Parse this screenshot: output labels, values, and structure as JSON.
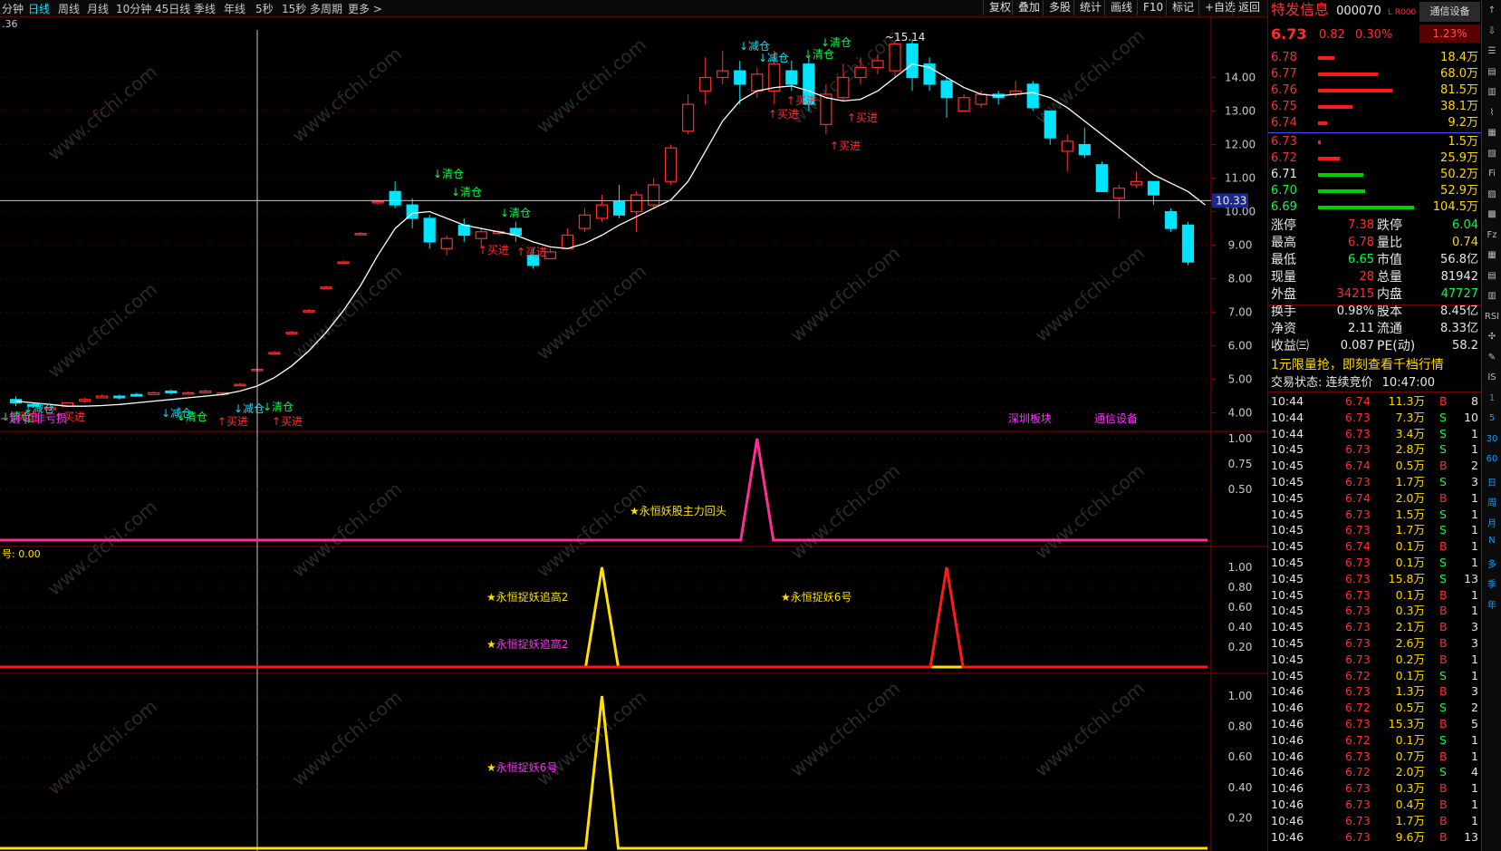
{
  "toolbar": {
    "tabs": [
      {
        "label": "分钟",
        "active": false
      },
      {
        "label": "日线",
        "active": true
      },
      {
        "label": "周线",
        "active": false
      },
      {
        "label": "月线",
        "active": false
      },
      {
        "label": "10分钟",
        "active": false
      },
      {
        "label": "45日线",
        "active": false
      },
      {
        "label": "季线",
        "active": false
      },
      {
        "label": "年线",
        "active": false
      },
      {
        "label": "5秒",
        "active": false
      },
      {
        "label": "15秒",
        "active": false
      },
      {
        "label": "多周期",
        "active": false
      },
      {
        "label": "更多 >",
        "active": false
      }
    ],
    "tools": [
      "复权",
      "叠加",
      "多股",
      "统计",
      "画线",
      "F10",
      "标记",
      "+自选",
      "返回"
    ]
  },
  "chart_data": [
    {
      "type": "candlestick",
      "title": "",
      "corner_label": ".36",
      "ylim": [
        3.8,
        15.5
      ],
      "yticks": [
        "14.00",
        "13.00",
        "12.00",
        "11.00",
        "10.00",
        "9.00",
        "8.00",
        "7.00",
        "6.00",
        "5.00",
        "4.00"
      ],
      "crosshair_price": "10.33",
      "candles": [
        {
          "o": 4.4,
          "c": 4.3,
          "h": 4.5,
          "l": 4.2
        },
        {
          "o": 4.25,
          "c": 4.2,
          "h": 4.3,
          "l": 4.15
        },
        {
          "o": 4.1,
          "c": 4.15,
          "h": 4.2,
          "l": 4.1
        },
        {
          "o": 4.2,
          "c": 4.3,
          "h": 4.3,
          "l": 4.2
        },
        {
          "o": 4.35,
          "c": 4.4,
          "h": 4.45,
          "l": 4.3
        },
        {
          "o": 4.45,
          "c": 4.5,
          "h": 4.55,
          "l": 4.45
        },
        {
          "o": 4.5,
          "c": 4.45,
          "h": 4.55,
          "l": 4.4
        },
        {
          "o": 4.55,
          "c": 4.5,
          "h": 4.6,
          "l": 4.5
        },
        {
          "o": 4.55,
          "c": 4.6,
          "h": 4.65,
          "l": 4.55
        },
        {
          "o": 4.65,
          "c": 4.6,
          "h": 4.7,
          "l": 4.55
        },
        {
          "o": 4.6,
          "c": 4.6,
          "h": 4.65,
          "l": 4.6
        },
        {
          "o": 4.6,
          "c": 4.65,
          "h": 4.7,
          "l": 4.6
        },
        {
          "o": 4.55,
          "c": 4.6,
          "h": 4.6,
          "l": 4.5
        },
        {
          "o": 4.85,
          "c": 4.85,
          "h": 4.9,
          "l": 4.8
        },
        {
          "o": 5.3,
          "c": 5.3,
          "h": 5.35,
          "l": 5.25
        },
        {
          "o": 5.8,
          "c": 5.8,
          "h": 5.85,
          "l": 5.75
        },
        {
          "o": 6.4,
          "c": 6.4,
          "h": 6.45,
          "l": 6.35
        },
        {
          "o": 7.05,
          "c": 7.05,
          "h": 7.1,
          "l": 7.0
        },
        {
          "o": 7.75,
          "c": 7.75,
          "h": 7.8,
          "l": 7.7
        },
        {
          "o": 8.5,
          "c": 8.5,
          "h": 8.55,
          "l": 8.45
        },
        {
          "o": 9.35,
          "c": 9.35,
          "h": 9.4,
          "l": 9.3
        },
        {
          "o": 10.3,
          "c": 10.3,
          "h": 10.35,
          "l": 10.2
        },
        {
          "o": 10.6,
          "c": 10.2,
          "h": 10.9,
          "l": 10.1
        },
        {
          "o": 10.2,
          "c": 9.8,
          "h": 10.4,
          "l": 9.5
        },
        {
          "o": 9.8,
          "c": 9.1,
          "h": 9.9,
          "l": 8.9
        },
        {
          "o": 8.9,
          "c": 9.2,
          "h": 9.3,
          "l": 8.7
        },
        {
          "o": 9.6,
          "c": 9.3,
          "h": 9.8,
          "l": 9.1
        },
        {
          "o": 9.2,
          "c": 9.4,
          "h": 9.5,
          "l": 8.9
        },
        {
          "o": 9.35,
          "c": 9.4,
          "h": 9.45,
          "l": 9.3
        },
        {
          "o": 9.5,
          "c": 9.3,
          "h": 9.7,
          "l": 9.1
        },
        {
          "o": 8.7,
          "c": 8.4,
          "h": 8.9,
          "l": 8.3
        },
        {
          "o": 8.6,
          "c": 8.8,
          "h": 8.9,
          "l": 8.6
        },
        {
          "o": 8.9,
          "c": 9.3,
          "h": 9.5,
          "l": 8.9
        },
        {
          "o": 9.5,
          "c": 9.9,
          "h": 10.1,
          "l": 9.4
        },
        {
          "o": 9.8,
          "c": 10.2,
          "h": 10.5,
          "l": 9.7
        },
        {
          "o": 10.3,
          "c": 9.9,
          "h": 10.8,
          "l": 9.8
        },
        {
          "o": 10.0,
          "c": 10.5,
          "h": 10.6,
          "l": 9.4
        },
        {
          "o": 10.2,
          "c": 10.8,
          "h": 11.0,
          "l": 10.1
        },
        {
          "o": 10.9,
          "c": 11.9,
          "h": 12.0,
          "l": 10.8
        },
        {
          "o": 12.4,
          "c": 13.2,
          "h": 13.5,
          "l": 12.3
        },
        {
          "o": 13.6,
          "c": 14.0,
          "h": 14.6,
          "l": 13.2
        },
        {
          "o": 14.0,
          "c": 14.2,
          "h": 14.8,
          "l": 13.8
        },
        {
          "o": 14.2,
          "c": 13.8,
          "h": 14.5,
          "l": 13.2
        },
        {
          "o": 13.6,
          "c": 14.1,
          "h": 14.3,
          "l": 13.4
        },
        {
          "o": 13.6,
          "c": 14.4,
          "h": 14.8,
          "l": 13.2
        },
        {
          "o": 14.2,
          "c": 13.8,
          "h": 14.5,
          "l": 13.6
        },
        {
          "o": 14.4,
          "c": 13.2,
          "h": 14.6,
          "l": 13.0
        },
        {
          "o": 12.6,
          "c": 13.5,
          "h": 13.8,
          "l": 12.3
        },
        {
          "o": 13.4,
          "c": 14.0,
          "h": 14.4,
          "l": 13.3
        },
        {
          "o": 14.0,
          "c": 14.3,
          "h": 14.6,
          "l": 13.8
        },
        {
          "o": 14.3,
          "c": 14.5,
          "h": 14.7,
          "l": 14.1
        },
        {
          "o": 14.2,
          "c": 15.0,
          "h": 15.1,
          "l": 14.0
        },
        {
          "o": 15.0,
          "c": 14.0,
          "h": 15.14,
          "l": 13.6
        },
        {
          "o": 14.4,
          "c": 13.8,
          "h": 14.6,
          "l": 13.6
        },
        {
          "o": 13.9,
          "c": 13.4,
          "h": 14.0,
          "l": 12.8
        },
        {
          "o": 13.0,
          "c": 13.4,
          "h": 13.5,
          "l": 13.0
        },
        {
          "o": 13.2,
          "c": 13.5,
          "h": 13.6,
          "l": 13.1
        },
        {
          "o": 13.5,
          "c": 13.4,
          "h": 13.6,
          "l": 13.2
        },
        {
          "o": 13.5,
          "c": 13.6,
          "h": 13.9,
          "l": 13.4
        },
        {
          "o": 13.8,
          "c": 13.1,
          "h": 13.9,
          "l": 13.0
        },
        {
          "o": 13.0,
          "c": 12.2,
          "h": 13.0,
          "l": 12.0
        },
        {
          "o": 11.8,
          "c": 12.1,
          "h": 12.3,
          "l": 11.2
        },
        {
          "o": 12.0,
          "c": 11.7,
          "h": 12.5,
          "l": 11.6
        },
        {
          "o": 11.4,
          "c": 10.6,
          "h": 11.5,
          "l": 10.6
        },
        {
          "o": 10.4,
          "c": 10.7,
          "h": 10.8,
          "l": 9.8
        },
        {
          "o": 10.8,
          "c": 10.9,
          "h": 11.2,
          "l": 10.7
        },
        {
          "o": 10.9,
          "c": 10.5,
          "h": 10.9,
          "l": 10.2
        },
        {
          "o": 10.0,
          "c": 9.5,
          "h": 10.1,
          "l": 9.4
        },
        {
          "o": 9.6,
          "c": 8.5,
          "h": 9.7,
          "l": 8.4
        }
      ],
      "ma": [
        4.35,
        4.3,
        4.25,
        4.2,
        4.2,
        4.22,
        4.25,
        4.3,
        4.35,
        4.4,
        4.45,
        4.5,
        4.55,
        4.65,
        4.8,
        5.05,
        5.4,
        5.85,
        6.4,
        7.05,
        7.8,
        8.7,
        9.5,
        9.95,
        10.0,
        9.8,
        9.6,
        9.5,
        9.4,
        9.3,
        9.1,
        8.95,
        8.9,
        9.05,
        9.3,
        9.6,
        9.85,
        10.1,
        10.35,
        10.9,
        11.8,
        12.7,
        13.3,
        13.6,
        13.7,
        13.75,
        13.6,
        13.4,
        13.3,
        13.35,
        13.6,
        14.0,
        14.4,
        14.3,
        14.0,
        13.7,
        13.5,
        13.45,
        13.5,
        13.55,
        13.4,
        13.1,
        12.7,
        12.3,
        11.9,
        11.5,
        11.1,
        10.85,
        10.6,
        10.2
      ],
      "annotations": [
        {
          "text": "↓减仓",
          "color": "#00e5ff"
        },
        {
          "text": "↓清仓",
          "color": "#00ff40"
        },
        {
          "text": "↑买进",
          "color": "#ff2d2d"
        },
        {
          "text": "~15.14",
          "color": "#e8e8e8"
        }
      ],
      "bottom_labels": [
        {
          "text": "~划 扣非亏损",
          "color": "#ff2dff"
        },
        {
          "text": "深圳板块",
          "color": "#ff2dff"
        },
        {
          "text": "通信设备",
          "color": "#ff2dff"
        }
      ]
    },
    {
      "type": "line",
      "title": "",
      "yticks": [
        "1.00",
        "0.75",
        "0.50"
      ],
      "signal_label": "★永恒妖股主力回头",
      "series": [
        {
          "name": "",
          "color": "#ff2d95",
          "spikes": [
            43
          ]
        }
      ]
    },
    {
      "type": "line",
      "title": "号: 0.00",
      "yticks": [
        "1.00",
        "0.80",
        "0.60",
        "0.40",
        "0.20"
      ],
      "signal_labels": [
        "★永恒捉妖追高2",
        "★永恒捉妖6号",
        "★永恒捉妖追高2"
      ],
      "series": [
        {
          "name": "",
          "color": "#ffe000",
          "spikes": [
            34
          ]
        },
        {
          "name": "",
          "color": "#ff1a1a",
          "spikes": [
            54
          ]
        }
      ]
    },
    {
      "type": "line",
      "title": "",
      "yticks": [
        "1.00",
        "0.80",
        "0.60",
        "0.40",
        "0.20"
      ],
      "signal_label": "★永恒捉妖6号",
      "series": [
        {
          "name": "",
          "color": "#ffe000",
          "spikes": [
            34
          ]
        }
      ]
    }
  ],
  "quote": {
    "name": "特发信息",
    "code": "000070",
    "tag": "L R000",
    "industry_btn": "通信设备",
    "industry_pct": "1.23%",
    "price": "6.73",
    "change": "0.82",
    "pct": "0.30%",
    "asks": [
      {
        "p": "6.78",
        "v": "18.4万",
        "bar": 0.15
      },
      {
        "p": "6.77",
        "v": "68.0万",
        "bar": 0.55
      },
      {
        "p": "6.76",
        "v": "81.5万",
        "bar": 0.68
      },
      {
        "p": "6.75",
        "v": "38.1万",
        "bar": 0.32
      },
      {
        "p": "6.74",
        "v": "9.2万",
        "bar": 0.08
      }
    ],
    "bids": [
      {
        "p": "6.73",
        "v": "1.5万",
        "bar": 0.02,
        "color": "red"
      },
      {
        "p": "6.72",
        "v": "25.9万",
        "bar": 0.2,
        "color": "red"
      },
      {
        "p": "6.71",
        "v": "50.2万",
        "bar": 0.42,
        "color": "white"
      },
      {
        "p": "6.70",
        "v": "52.9万",
        "bar": 0.43,
        "color": "green"
      },
      {
        "p": "6.69",
        "v": "104.5万",
        "bar": 0.88,
        "color": "green"
      }
    ],
    "stats": [
      [
        {
          "k": "涨停",
          "v": "7.38",
          "c": "red"
        },
        {
          "k": "跌停",
          "v": "6.04",
          "c": "green"
        }
      ],
      [
        {
          "k": "最高",
          "v": "6.78",
          "c": "red"
        },
        {
          "k": "量比",
          "v": "0.74",
          "c": "yellow"
        }
      ],
      [
        {
          "k": "最低",
          "v": "6.65",
          "c": "green"
        },
        {
          "k": "市值",
          "v": "56.8亿",
          "c": "white"
        }
      ],
      [
        {
          "k": "现量",
          "v": "28",
          "c": "red"
        },
        {
          "k": "总量",
          "v": "81942",
          "c": "white"
        }
      ],
      [
        {
          "k": "外盘",
          "v": "34215",
          "c": "red"
        },
        {
          "k": "内盘",
          "v": "47727",
          "c": "green"
        }
      ],
      [
        {
          "k": "换手",
          "v": "0.98%",
          "c": "white"
        },
        {
          "k": "股本",
          "v": "8.45亿",
          "c": "white"
        }
      ],
      [
        {
          "k": "净资",
          "v": "2.11",
          "c": "white"
        },
        {
          "k": "流通",
          "v": "8.33亿",
          "c": "white"
        }
      ],
      [
        {
          "k": "收益㈢",
          "v": "0.087",
          "c": "white"
        },
        {
          "k": "PE(动)",
          "v": "58.2",
          "c": "white"
        }
      ]
    ],
    "promo": "1元限量抢，即刻查看千档行情",
    "trade_status_label": "交易状态: 连续竞价",
    "trade_status_time": "10:47:00",
    "ticks": [
      [
        "10:44",
        "6.74",
        "11.3万",
        "B",
        "8"
      ],
      [
        "10:44",
        "6.73",
        "7.3万",
        "S",
        "10"
      ],
      [
        "10:44",
        "6.73",
        "3.4万",
        "S",
        "1"
      ],
      [
        "10:45",
        "6.73",
        "2.8万",
        "S",
        "1"
      ],
      [
        "10:45",
        "6.74",
        "0.5万",
        "B",
        "2"
      ],
      [
        "10:45",
        "6.73",
        "1.7万",
        "S",
        "3"
      ],
      [
        "10:45",
        "6.74",
        "2.0万",
        "B",
        "1"
      ],
      [
        "10:45",
        "6.73",
        "1.5万",
        "S",
        "1"
      ],
      [
        "10:45",
        "6.73",
        "1.7万",
        "S",
        "1"
      ],
      [
        "10:45",
        "6.74",
        "0.1万",
        "B",
        "1"
      ],
      [
        "10:45",
        "6.73",
        "0.1万",
        "S",
        "1"
      ],
      [
        "10:45",
        "6.73",
        "15.8万",
        "S",
        "13"
      ],
      [
        "10:45",
        "6.73",
        "0.1万",
        "B",
        "1"
      ],
      [
        "10:45",
        "6.73",
        "0.3万",
        "B",
        "1"
      ],
      [
        "10:45",
        "6.73",
        "2.1万",
        "B",
        "3"
      ],
      [
        "10:45",
        "6.73",
        "2.6万",
        "B",
        "3"
      ],
      [
        "10:45",
        "6.73",
        "0.2万",
        "B",
        "1"
      ],
      [
        "10:45",
        "6.72",
        "0.1万",
        "S",
        "1"
      ],
      [
        "10:46",
        "6.73",
        "1.3万",
        "B",
        "3"
      ],
      [
        "10:46",
        "6.72",
        "0.5万",
        "S",
        "2"
      ],
      [
        "10:46",
        "6.73",
        "15.3万",
        "B",
        "5"
      ],
      [
        "10:46",
        "6.72",
        "0.1万",
        "S",
        "1"
      ],
      [
        "10:46",
        "6.73",
        "0.7万",
        "B",
        "1"
      ],
      [
        "10:46",
        "6.72",
        "2.0万",
        "S",
        "4"
      ],
      [
        "10:46",
        "6.73",
        "0.3万",
        "B",
        "1"
      ],
      [
        "10:46",
        "6.73",
        "0.4万",
        "B",
        "1"
      ],
      [
        "10:46",
        "6.73",
        "1.7万",
        "B",
        "1"
      ],
      [
        "10:46",
        "6.73",
        "9.6万",
        "B",
        "13"
      ]
    ]
  },
  "sidebar": {
    "items": [
      "↑",
      "⇩",
      "☰",
      "▤",
      "▥",
      "⌇",
      "▦",
      "▧",
      "Fi",
      "▨",
      "▩",
      "Fz",
      "▦",
      "▤",
      "▥",
      "RSI",
      "✣",
      "✎",
      "IS",
      "1",
      "5",
      "30",
      "60",
      "日",
      "周",
      "月",
      "N",
      "多",
      "季",
      "年"
    ]
  },
  "watermark": "www.cfchi.com"
}
